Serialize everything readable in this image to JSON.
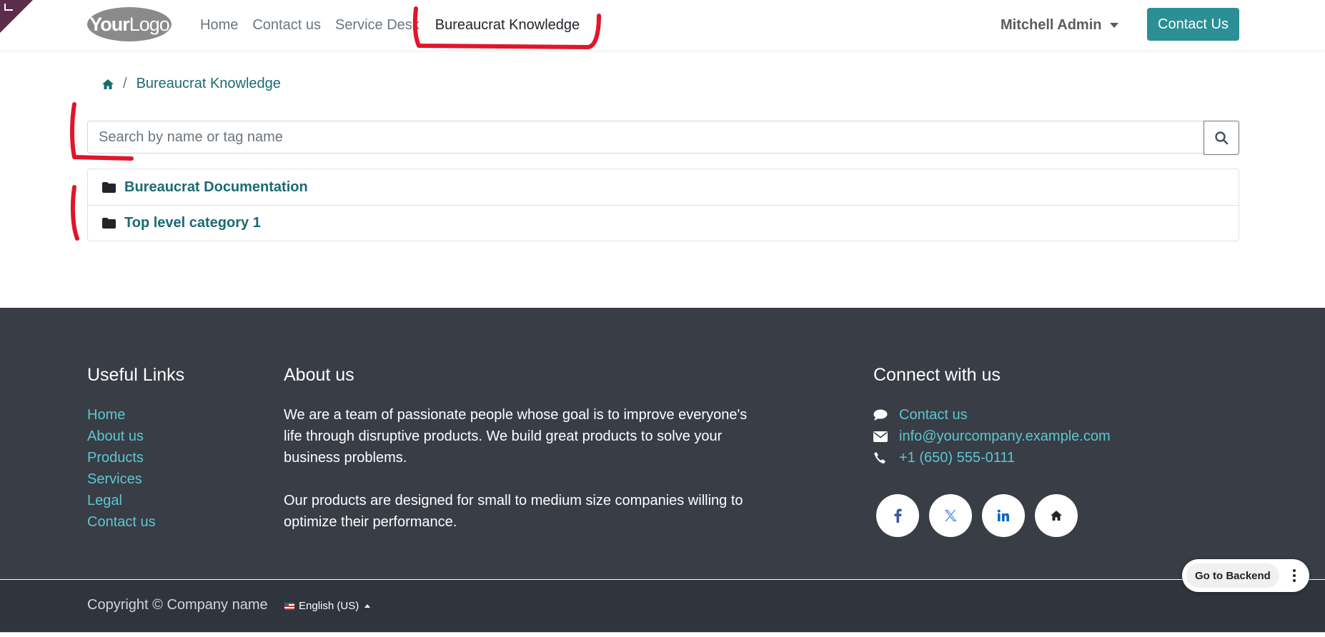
{
  "header": {
    "logo_text_bold": "Your",
    "logo_text_light": "Logo",
    "nav": [
      {
        "label": "Home"
      },
      {
        "label": "Contact us"
      },
      {
        "label": "Service Desk"
      },
      {
        "label": "Bureaucrat Knowledge"
      }
    ],
    "user_name": "Mitchell Admin",
    "contact_button": "Contact Us"
  },
  "breadcrumb": {
    "home_icon": "home-icon",
    "separator": "/",
    "current": "Bureaucrat Knowledge"
  },
  "search": {
    "placeholder": "Search by name or tag name",
    "value": "",
    "icon": "search-icon"
  },
  "categories": [
    {
      "icon": "folder-icon",
      "label": "Bureaucrat Documentation"
    },
    {
      "icon": "folder-icon",
      "label": "Top level category 1"
    }
  ],
  "footer": {
    "useful_links": {
      "title": "Useful Links",
      "items": [
        "Home",
        "About us",
        "Products",
        "Services",
        "Legal",
        "Contact us"
      ]
    },
    "about": {
      "title": "About us",
      "p1": "We are a team of passionate people whose goal is to improve everyone's life through disruptive products. We build great products to solve your business problems.",
      "p2": "Our products are designed for small to medium size companies willing to optimize their performance."
    },
    "connect": {
      "title": "Connect with us",
      "items": [
        {
          "icon": "comment-icon",
          "label": "Contact us"
        },
        {
          "icon": "envelope-icon",
          "label": "info@yourcompany.example.com"
        },
        {
          "icon": "phone-icon",
          "label": "+1 (650) 555-0111"
        }
      ],
      "socials": [
        "facebook-icon",
        "x-twitter-icon",
        "linkedin-icon",
        "home-icon"
      ]
    },
    "copyright": "Copyright © Company name",
    "language": "English (US)"
  },
  "backend_button": "Go to Backend",
  "colors": {
    "accent": "#2b8f95",
    "link": "#1a6b71",
    "footer_bg": "#383d46",
    "footer_link": "#5dc7cf",
    "annotation": "#e0162b"
  }
}
